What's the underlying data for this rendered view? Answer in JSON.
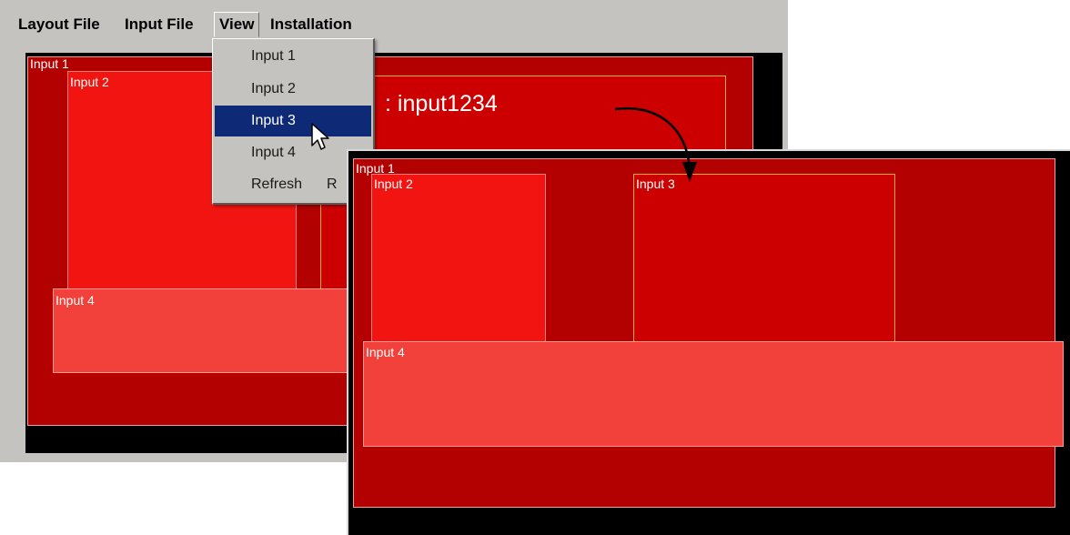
{
  "menubar": {
    "layout_file": "Layout File",
    "input_file": "Input File",
    "view": "View",
    "installation": "Installation"
  },
  "view_menu": {
    "items": [
      {
        "label": "Input 1",
        "shortcut": ""
      },
      {
        "label": "Input 2",
        "shortcut": ""
      },
      {
        "label": "Input 3",
        "shortcut": ""
      },
      {
        "label": "Input 4",
        "shortcut": ""
      },
      {
        "label": "Refresh",
        "shortcut": "R"
      }
    ],
    "selected_index": 2
  },
  "back_layout": {
    "input1_label": "Input 1",
    "input2_label": "Input 2",
    "input3_caption": ": input1234",
    "input4_label": "Input 4"
  },
  "front_layout": {
    "input1_label": "Input 1",
    "input2_label": "Input 2",
    "input3_label": "Input 3",
    "input4_label": "Input 4"
  },
  "colors": {
    "window_gray": "#c4c3bf",
    "input1_red": "#b30000",
    "input2_red": "#f11410",
    "input3_red": "#cc0000",
    "input3_border": "#ffae1a",
    "input4_red": "#f2403a",
    "selection_blue": "#0e2a77"
  },
  "icons": [
    "mouse-cursor-icon",
    "curved-arrow-icon"
  ]
}
